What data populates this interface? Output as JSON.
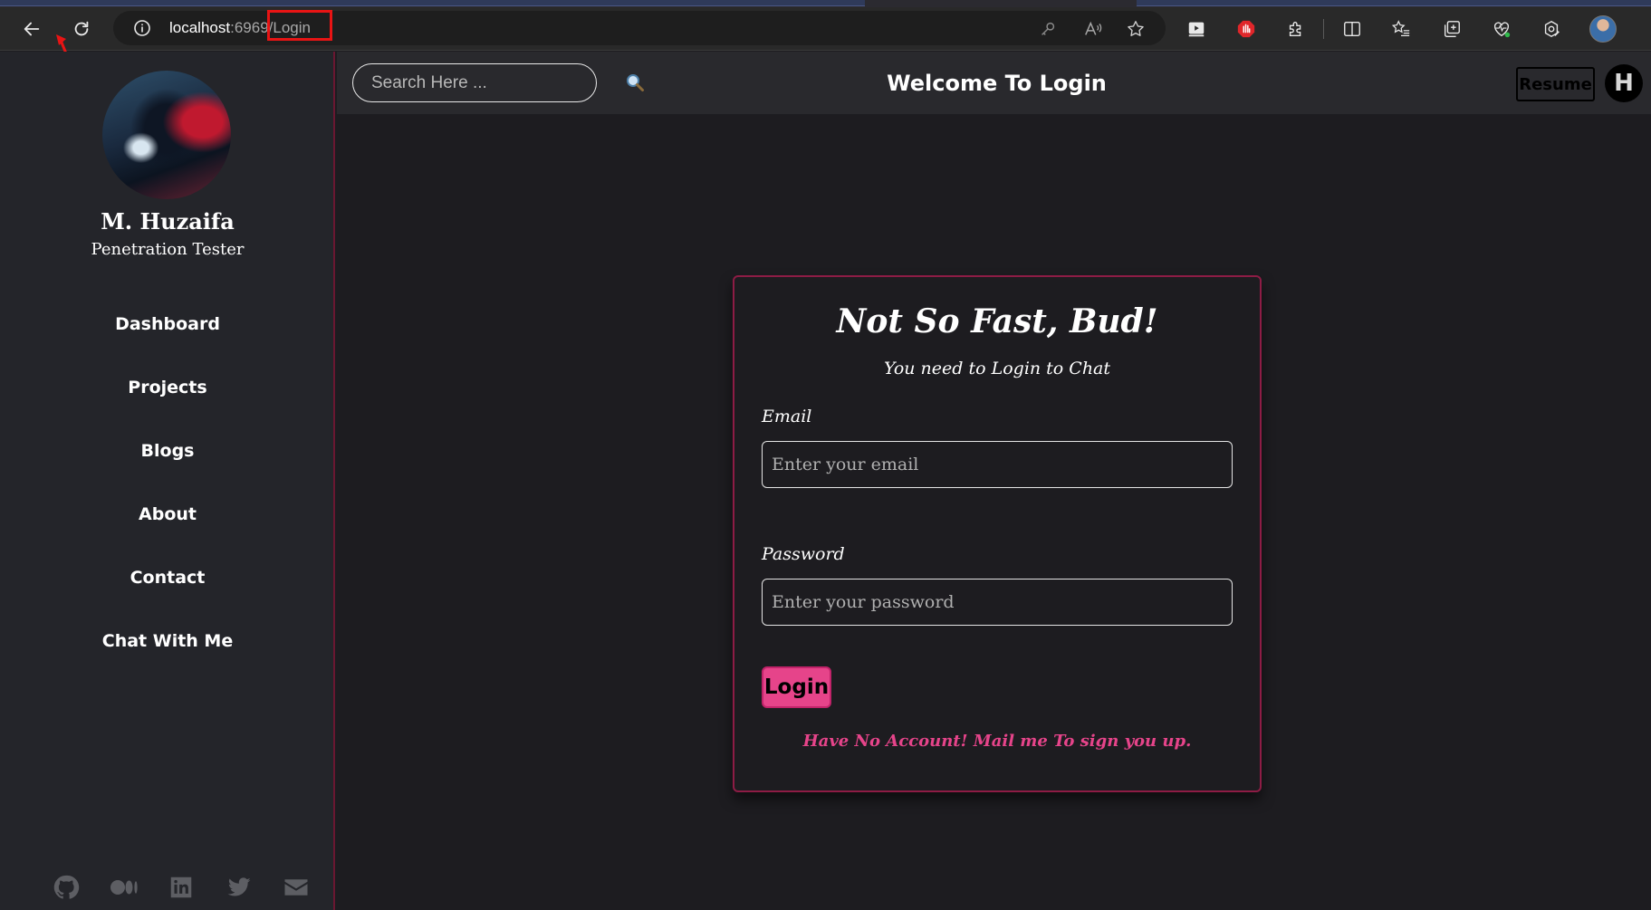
{
  "browser": {
    "url_host": "localhost",
    "url_port": ":6969",
    "url_path": "/Login"
  },
  "sidebar": {
    "name": "M. Huzaifa",
    "role": "Penetration Tester",
    "items": [
      {
        "label": "Dashboard"
      },
      {
        "label": "Projects"
      },
      {
        "label": "Blogs"
      },
      {
        "label": "About"
      },
      {
        "label": "Contact"
      },
      {
        "label": "Chat With Me"
      }
    ],
    "socials": [
      "github-icon",
      "medium-icon",
      "linkedin-icon",
      "twitter-icon",
      "mail-icon"
    ]
  },
  "header": {
    "search_placeholder": "Search Here ...",
    "title": "Welcome To Login",
    "resume_label": "Resume",
    "theme_letter": "H"
  },
  "login": {
    "heading": "Not So Fast, Bud!",
    "subtitle": "You need to Login to Chat",
    "email_label": "Email",
    "email_placeholder": "Enter your email",
    "password_label": "Password",
    "password_placeholder": "Enter your password",
    "button_label": "Login",
    "signup_note": "Have No Account! Mail me To sign you up."
  },
  "colors": {
    "accent": "#e6448a",
    "card_border": "#8d1c45",
    "background": "#1d1c20",
    "sidebar": "#24252a"
  }
}
